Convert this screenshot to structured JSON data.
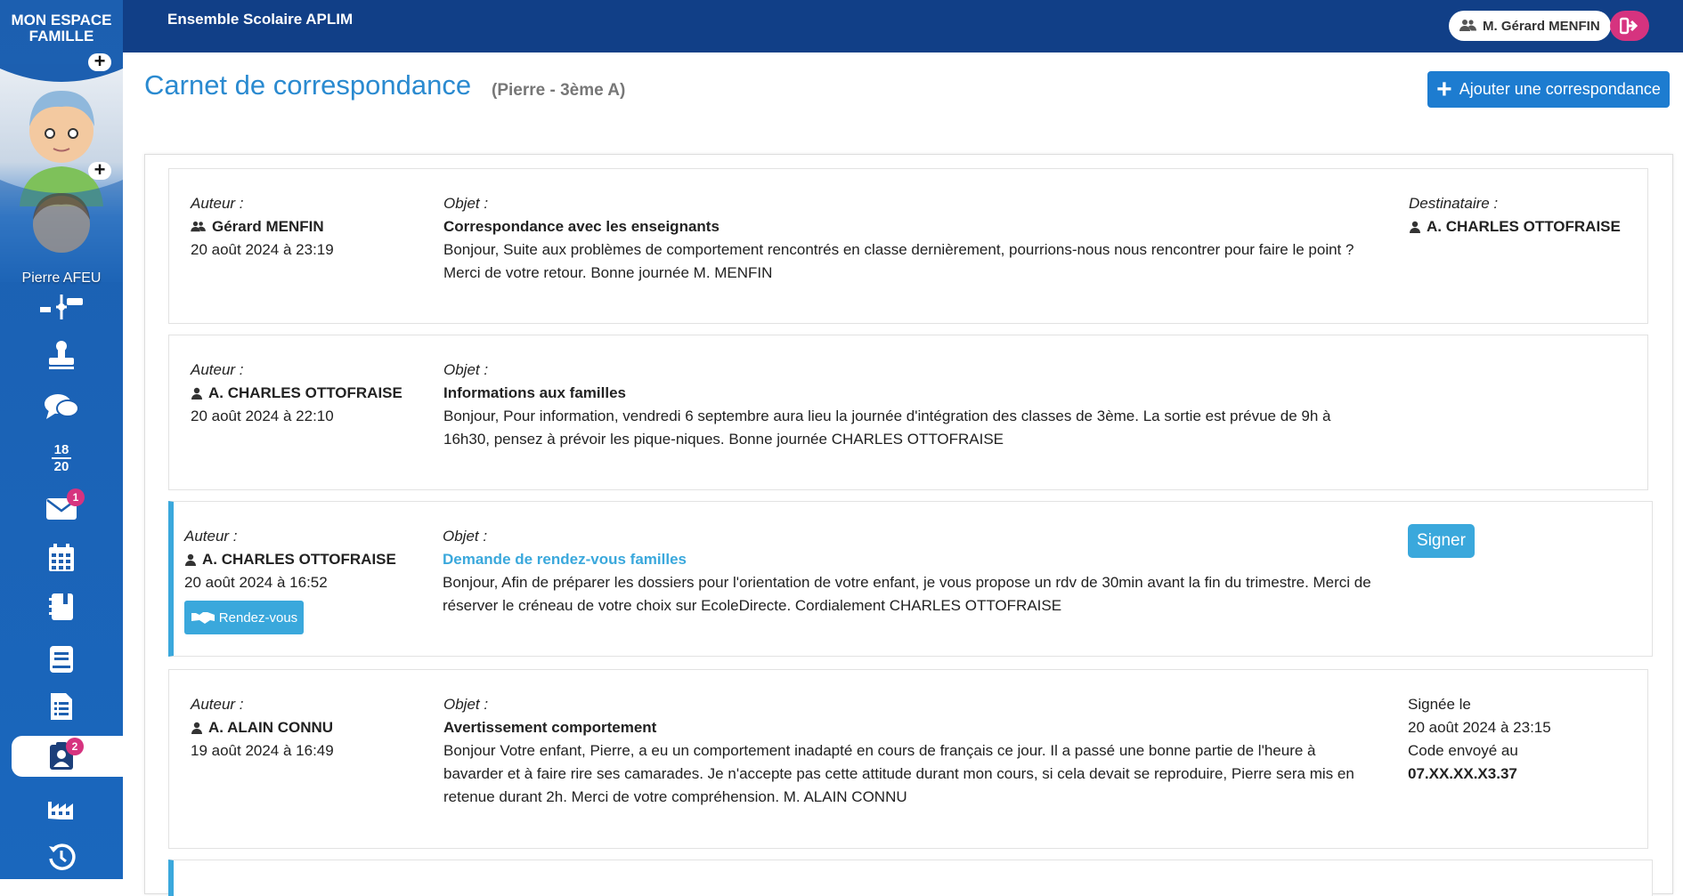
{
  "topbar": {
    "school_name": "Ensemble Scolaire APLIM",
    "user_name": "M. Gérard MENFIN",
    "user_icon": "users-icon",
    "logout_icon": "logout-icon"
  },
  "sidebar": {
    "brand_line1": "MON ESPACE",
    "brand_line2": "FAMILLE",
    "child_name": "Pierre AFEU",
    "plus_label": "+",
    "grade_numerator": "18",
    "grade_denominator": "20",
    "items": [
      {
        "icon": "timeline-icon"
      },
      {
        "icon": "stamp-icon"
      },
      {
        "icon": "chat-icon"
      },
      {
        "icon": "grades-icon"
      },
      {
        "icon": "envelope-icon",
        "badge": "1"
      },
      {
        "icon": "calendar-icon"
      },
      {
        "icon": "notebook-icon"
      },
      {
        "icon": "book-icon"
      },
      {
        "icon": "document-list-icon"
      },
      {
        "icon": "correspondence-icon",
        "badge": "2",
        "active": true
      },
      {
        "icon": "factory-icon"
      },
      {
        "icon": "history-icon"
      }
    ]
  },
  "header": {
    "title": "Carnet de correspondance",
    "subtitle": "(Pierre - 3ème A)",
    "add_button_label": "Ajouter une correspondance",
    "add_button_icon": "+"
  },
  "labels": {
    "author": "Auteur :",
    "subject": "Objet :",
    "recipient": "Destinataire :",
    "signed_on": "Signée le",
    "code_sent": "Code envoyé au",
    "sign_button": "Signer",
    "appointment_button": "Rendez-vous"
  },
  "entries": [
    {
      "author": "Gérard MENFIN",
      "author_icon": "users-icon",
      "date": "20 août 2024 à 23:19",
      "subject": "Correspondance avec les enseignants",
      "body": "Bonjour, Suite aux problèmes de comportement rencontrés en classe dernièrement, pourrions-nous nous rencontrer pour faire le point ? Merci de votre retour. Bonne journée M. MENFIN",
      "recipient": "A. CHARLES OTTOFRAISE"
    },
    {
      "author": "A. CHARLES OTTOFRAISE",
      "author_icon": "teacher-icon",
      "date": "20 août 2024 à 22:10",
      "subject": "Informations aux familles",
      "body": "Bonjour, Pour information, vendredi 6 septembre aura lieu la journée d'intégration des classes de 3ème. La sortie est prévue de 9h à 16h30, pensez à prévoir les pique-niques. Bonne journée CHARLES OTTOFRAISE"
    },
    {
      "author": "A. CHARLES OTTOFRAISE",
      "author_icon": "teacher-icon",
      "date": "20 août 2024 à 16:52",
      "subject": "Demande de rendez-vous familles",
      "body": "Bonjour, Afin de préparer les dossiers pour l'orientation de votre enfant, je vous propose un rdv de 30min avant la fin du trimestre. Merci de réserver le créneau de votre choix sur EcoleDirecte. Cordialement CHARLES OTTOFRAISE",
      "highlight_color": "#3aa8dc"
    },
    {
      "author": "A. ALAIN CONNU",
      "author_icon": "teacher-icon",
      "date": "19 août 2024 à 16:49",
      "subject": "Avertissement comportement",
      "body": "Bonjour Votre enfant, Pierre, a eu un comportement inadapté en cours de français ce jour. Il a passé une bonne partie de l'heure à bavarder et à faire rire ses camarades. Je n'accepte pas cette attitude durant mon cours, si cela devait se reproduire, Pierre sera mis en retenue durant 2h. Merci de votre compréhension. M. ALAIN CONNU",
      "signed_date": "20 août 2024 à 23:15",
      "phone": "07.XX.XX.X3.37"
    }
  ],
  "colors": {
    "topbar": "#113f87",
    "accent": "#2a8ad0",
    "button": "#3aa8dc",
    "badge": "#d6337f"
  }
}
